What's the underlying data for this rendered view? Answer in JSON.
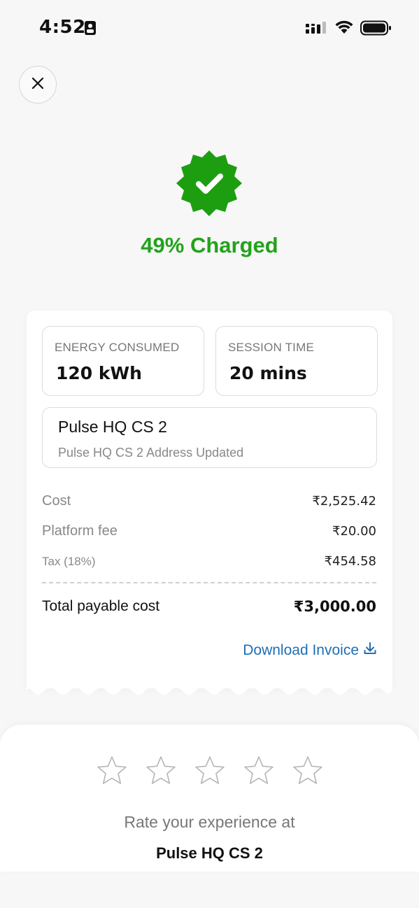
{
  "status_bar": {
    "time": "4:52",
    "icons": [
      "portrait-lock-icon",
      "cellular-signal-icon",
      "wifi-icon",
      "battery-icon"
    ]
  },
  "header": {
    "close_icon": "close-icon"
  },
  "status": {
    "badge_icon": "verified-badge-icon",
    "title": "49% Charged",
    "accent_color": "#21a31a"
  },
  "stats": {
    "energy": {
      "label": "ENERGY CONSUMED",
      "value": "120 kWh"
    },
    "session": {
      "label": "SESSION TIME",
      "value": "20 mins"
    }
  },
  "station": {
    "name": "Pulse HQ CS 2",
    "address": "Pulse HQ CS 2 Address Updated"
  },
  "fees": {
    "cost": {
      "label": "Cost",
      "value": "₹2,525.42"
    },
    "platform": {
      "label": "Platform fee",
      "value": "₹20.00"
    },
    "tax": {
      "label": "Tax (18%)",
      "value": "₹454.58"
    },
    "total": {
      "label": "Total payable cost",
      "value": "₹3,000.00"
    }
  },
  "invoice": {
    "label": "Download Invoice",
    "icon": "download-icon",
    "link_color": "#1f6fb5"
  },
  "rating": {
    "max_stars": 5,
    "selected": 0,
    "prompt": "Rate your experience at",
    "station": "Pulse HQ CS 2"
  }
}
